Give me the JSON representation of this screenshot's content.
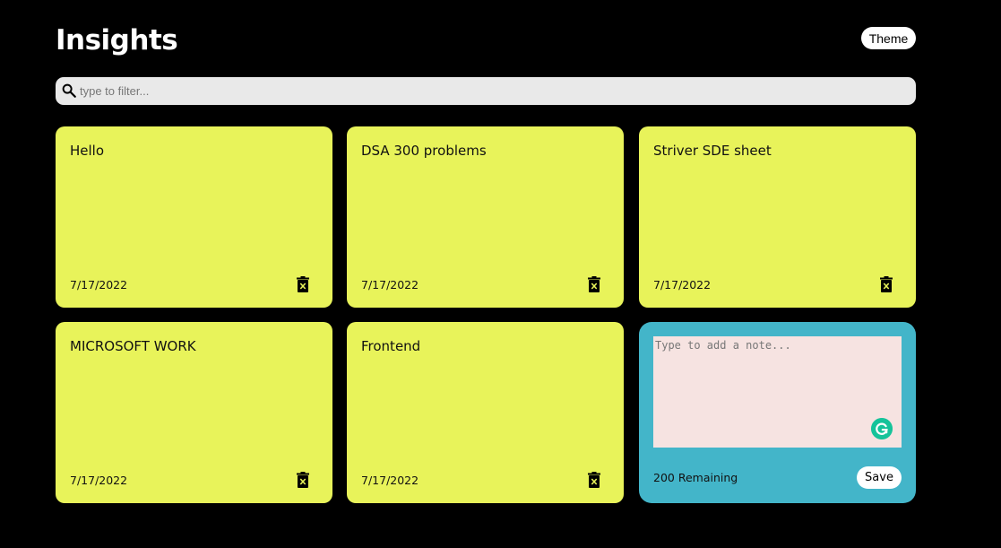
{
  "header": {
    "title": "Insights",
    "theme_label": "Theme"
  },
  "search": {
    "placeholder": "type to filter...",
    "value": ""
  },
  "notes": [
    {
      "text": "Hello",
      "date": "7/17/2022"
    },
    {
      "text": "DSA 300 problems",
      "date": "7/17/2022"
    },
    {
      "text": "Striver SDE sheet",
      "date": "7/17/2022"
    },
    {
      "text": "MICROSOFT WORK",
      "date": "7/17/2022"
    },
    {
      "text": "Frontend",
      "date": "7/17/2022"
    }
  ],
  "new_note": {
    "placeholder": "Type to add a note...",
    "value": "",
    "remaining": "200 Remaining",
    "save_label": "Save"
  },
  "icons": {
    "search": "search-icon",
    "delete": "trash-icon",
    "grammarly": "grammarly-icon"
  },
  "colors": {
    "background": "#000000",
    "note": "#e8f35a",
    "new_note": "#43b5c9",
    "textarea": "#f6e3e1",
    "search_bar": "#e9e9e9",
    "grammarly": "#15c39a"
  }
}
